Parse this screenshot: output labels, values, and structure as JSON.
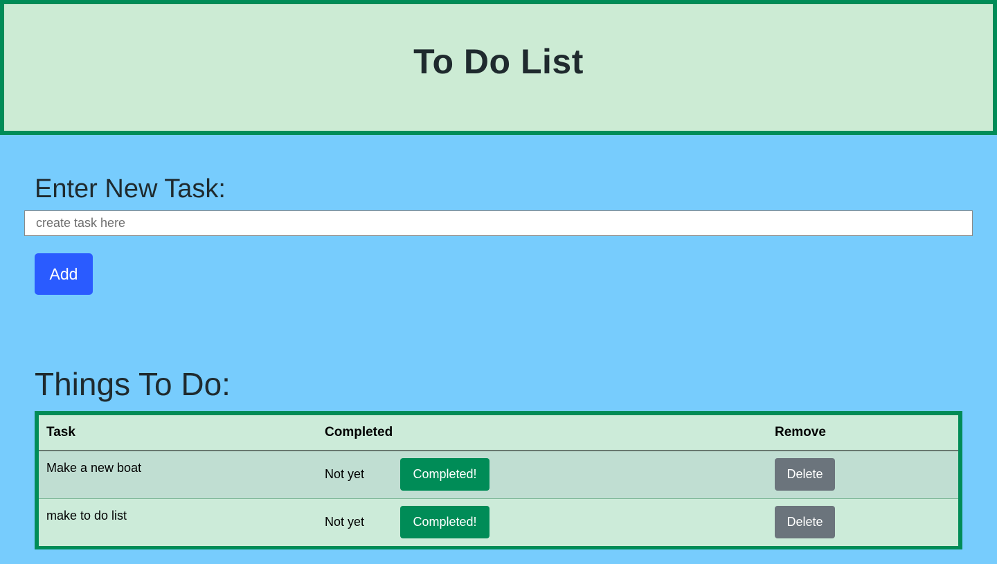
{
  "header": {
    "title": "To Do List"
  },
  "form": {
    "label": "Enter New Task:",
    "input_placeholder": "create task here",
    "input_value": "",
    "add_label": "Add"
  },
  "list": {
    "title": "Things To Do:",
    "columns": [
      "Task",
      "Completed",
      "Remove"
    ],
    "rows": [
      {
        "task": "Make a new boat",
        "status": "Not yet",
        "complete_label": "Completed!",
        "delete_label": "Delete"
      },
      {
        "task": "make to do list",
        "status": "Not yet",
        "complete_label": "Completed!",
        "delete_label": "Delete"
      }
    ]
  },
  "colors": {
    "background": "#77ccfd",
    "header_bg": "#ccebd4",
    "accent_green": "#008c57",
    "add_button": "#2a5bff",
    "delete_button": "#6b747c"
  }
}
